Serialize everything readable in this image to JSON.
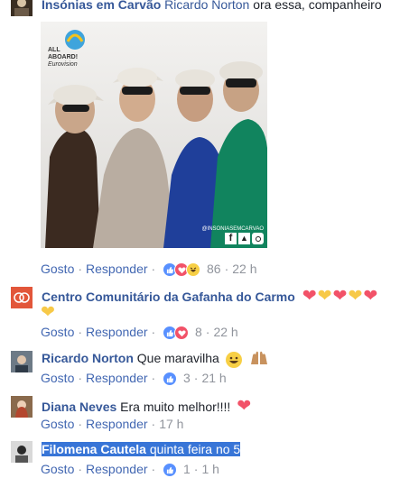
{
  "comments": [
    {
      "author": "Insónias em Carvão",
      "mention": "Ricardo Norton",
      "text": " ora essa, companheiro",
      "photo": {
        "badge": "ALL ABOARD!",
        "badge_sub": "Eurovision",
        "watermark": "@INSONIASEMCARVAO"
      },
      "like_label": "Gosto",
      "reply_label": "Responder",
      "reaction_count": "86",
      "time": "22 h"
    },
    {
      "author": "Centro Comunitário da Gafanha do Carmo",
      "like_label": "Gosto",
      "reply_label": "Responder",
      "reaction_count": "8",
      "time": "22 h"
    },
    {
      "author": "Ricardo Norton",
      "text": "Que maravilha",
      "like_label": "Gosto",
      "reply_label": "Responder",
      "reaction_count": "3",
      "time": "21 h"
    },
    {
      "author": "Diana Neves",
      "text": "Era muito melhor!!!!",
      "like_label": "Gosto",
      "reply_label": "Responder",
      "time": "17 h"
    },
    {
      "author": "Filomena Cautela",
      "text": "quinta feira no 5",
      "like_label": "Gosto",
      "reply_label": "Responder",
      "reaction_count": "1",
      "time": "1 h"
    }
  ],
  "colors": {
    "link": "#365899",
    "meta": "#90949c",
    "like": "#5890ff",
    "love": "#f25268",
    "selection": "#3875d7"
  }
}
